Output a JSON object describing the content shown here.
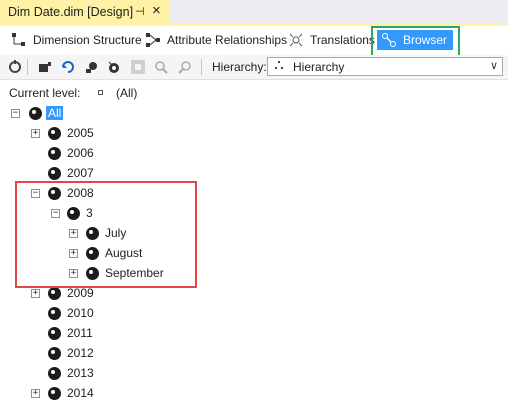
{
  "window": {
    "tab_title": "Dim Date.dim [Design]",
    "pin_icon": "pin-icon",
    "close_icon": "close-icon"
  },
  "designer_tabs": [
    {
      "label": "Dimension Structure",
      "icon": "dimension-structure-icon"
    },
    {
      "label": "Attribute Relationships",
      "icon": "attribute-relationships-icon"
    },
    {
      "label": "Translations",
      "icon": "translations-icon"
    },
    {
      "label": "Browser",
      "icon": "browser-icon",
      "active": true
    }
  ],
  "toolbar": {
    "hierarchy_label": "Hierarchy:",
    "hierarchy_value": "Hierarchy"
  },
  "current_level": {
    "label": "Current level:",
    "value": "(All)"
  },
  "tree": [
    {
      "label": "All",
      "expander": "−"
    },
    {
      "label": "2005",
      "expander": "+"
    },
    {
      "label": "2006"
    },
    {
      "label": "2007"
    },
    {
      "label": "2008",
      "expander": "−"
    },
    {
      "label": "3",
      "expander": "−"
    },
    {
      "label": "July",
      "expander": "+"
    },
    {
      "label": "August",
      "expander": "+"
    },
    {
      "label": "September",
      "expander": "+"
    },
    {
      "label": "2009",
      "expander": "+"
    },
    {
      "label": "2010"
    },
    {
      "label": "2011"
    },
    {
      "label": "2012"
    },
    {
      "label": "2013"
    },
    {
      "label": "2014",
      "expander": "+"
    }
  ],
  "colors": {
    "tab_active": "#fff1a5",
    "browser_tab": "#3399ff",
    "green_highlight": "#27a86a",
    "red_highlight": "#e04848"
  }
}
